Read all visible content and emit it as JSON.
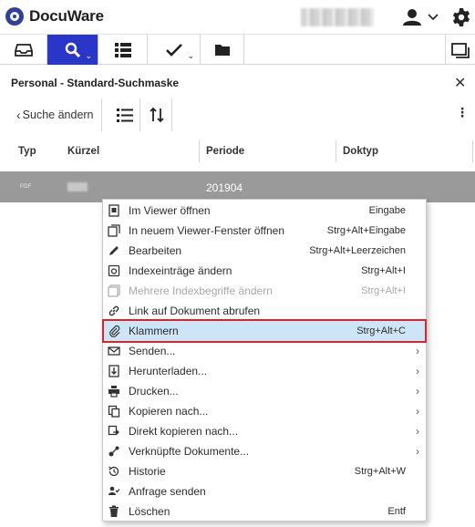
{
  "header": {
    "app_name": "DocuWare"
  },
  "search": {
    "title": "Personal - Standard-Suchmaske",
    "back_label": "Suche ändern"
  },
  "table": {
    "columns": [
      "Typ",
      "Kürzel",
      "Periode",
      "Doktyp"
    ],
    "selected_row": {
      "type_icon": "PDF",
      "period": "201904"
    }
  },
  "context_menu": {
    "items": [
      {
        "icon": "viewer-icon",
        "label": "Im Viewer öffnen",
        "shortcut": "Eingabe"
      },
      {
        "icon": "new-window-icon",
        "label": "In neuem Viewer-Fenster öffnen",
        "shortcut": "Strg+Alt+Eingabe"
      },
      {
        "icon": "pencil-icon",
        "label": "Bearbeiten",
        "shortcut": "Strg+Alt+Leerzeichen"
      },
      {
        "icon": "index-edit-icon",
        "label": "Indexeinträge ändern",
        "shortcut": "Strg+Alt+I"
      },
      {
        "icon": "multi-index-icon",
        "label": "Mehrere Indexbegriffe ändern",
        "shortcut": "Strg+Alt+I",
        "disabled": true
      },
      {
        "icon": "link-icon",
        "label": "Link auf Dokument abrufen",
        "shortcut": ""
      },
      {
        "icon": "paperclip-icon",
        "label": "Klammern",
        "shortcut": "Strg+Alt+C",
        "highlighted": true
      },
      {
        "icon": "envelope-icon",
        "label": "Senden...",
        "submenu": true
      },
      {
        "icon": "download-icon",
        "label": "Herunterladen...",
        "submenu": true
      },
      {
        "icon": "printer-icon",
        "label": "Drucken...",
        "submenu": true
      },
      {
        "icon": "copy-icon",
        "label": "Kopieren nach...",
        "submenu": true
      },
      {
        "icon": "direct-copy-icon",
        "label": "Direkt kopieren nach...",
        "submenu": true
      },
      {
        "icon": "linked-docs-icon",
        "label": "Verknüpfte Dokumente...",
        "submenu": true
      },
      {
        "icon": "history-icon",
        "label": "Historie",
        "shortcut": "Strg+Alt+W"
      },
      {
        "icon": "request-icon",
        "label": "Anfrage senden",
        "shortcut": ""
      },
      {
        "icon": "trash-icon",
        "label": "Löschen",
        "shortcut": "Entf"
      }
    ],
    "submenu_arrow": "›"
  },
  "colors": {
    "accent": "#2a36c8",
    "selected_row": "#9a9a9a",
    "menu_highlight": "#cde6f7",
    "highlight_border": "#d9232e"
  }
}
